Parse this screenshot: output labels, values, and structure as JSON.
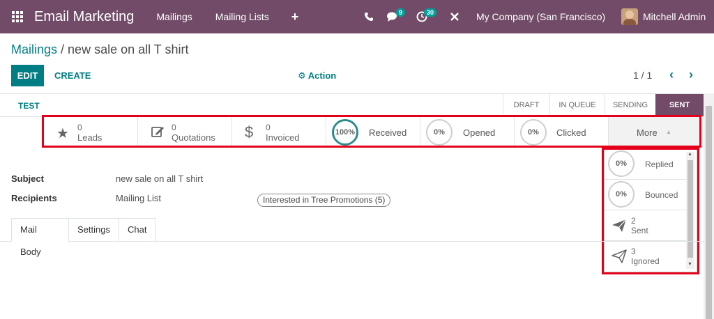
{
  "navbar": {
    "app_title": "Email Marketing",
    "menus": [
      "Mailings",
      "Mailing Lists"
    ],
    "plus": "+",
    "messages_badge": "9",
    "activities_badge": "30",
    "company": "My Company (San Francisco)",
    "user": "Mitchell Admin"
  },
  "breadcrumb": {
    "parent": "Mailings",
    "separator": " / ",
    "current": "new sale on all T shirt"
  },
  "controls": {
    "edit": "EDIT",
    "create": "CREATE",
    "action": "Action",
    "pager": "1 / 1"
  },
  "statusbar": {
    "test": "TEST",
    "stages": [
      "DRAFT",
      "IN QUEUE",
      "SENDING",
      "SENT"
    ],
    "active_stage": "SENT"
  },
  "smart_buttons": {
    "leads": {
      "value": "0",
      "label": "Leads"
    },
    "quotations": {
      "value": "0",
      "label": "Quotations"
    },
    "invoiced": {
      "value": "0",
      "label": "Invoiced"
    },
    "received": {
      "value": "100%",
      "label": "Received"
    },
    "opened": {
      "value": "0%",
      "label": "Opened"
    },
    "clicked": {
      "value": "0%",
      "label": "Clicked"
    },
    "more": "More"
  },
  "dropdown": {
    "replied": {
      "value": "0%",
      "label": "Replied"
    },
    "bounced": {
      "value": "0%",
      "label": "Bounced"
    },
    "sent": {
      "value": "2",
      "label": "Sent"
    },
    "ignored": {
      "value": "3",
      "label": "Ignored"
    }
  },
  "fields": {
    "subject_label": "Subject",
    "subject_value": "new sale on all T shirt",
    "recipients_label": "Recipients",
    "recipients_value": "Mailing List",
    "recipients_tag": "Interested in Tree Promotions (5)"
  },
  "tabs": [
    "Mail Body",
    "Settings",
    "Chat"
  ],
  "colors": {
    "brand": "#714B67",
    "accent": "#017e84",
    "highlight": "#e4001b",
    "received_ring": "#2e8b8b"
  }
}
